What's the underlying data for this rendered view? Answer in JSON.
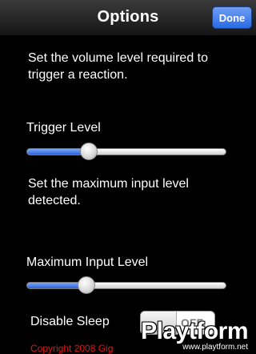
{
  "navbar": {
    "title": "Options",
    "done_label": "Done"
  },
  "trigger": {
    "description": "Set the volume level required to trigger a reaction.",
    "label": "Trigger Level",
    "value_fraction": 0.31
  },
  "max_input": {
    "description": "Set the maximum input level detected.",
    "label": "Maximum Input Level",
    "value_fraction": 0.3
  },
  "sleep": {
    "label": "Disable Sleep",
    "toggle_text": "OFF"
  },
  "footer": {
    "copyright": "Copyright 2008 Gig"
  },
  "watermark": {
    "logo": "Playtform",
    "url": "www.playtform.net"
  },
  "colors": {
    "accent": "#2a6ae4",
    "copyright_red": "#e01616",
    "background": "#000000"
  }
}
